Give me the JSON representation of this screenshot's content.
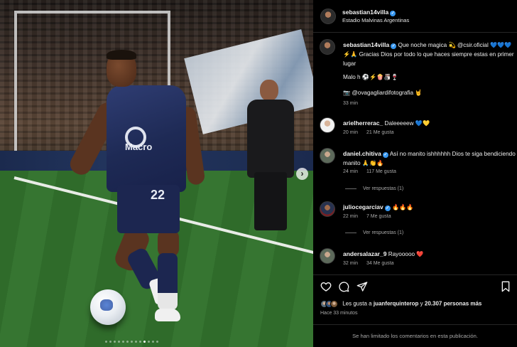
{
  "photo": {
    "sponsor": "Macro",
    "number": "22",
    "nav_arrow": "›",
    "carousel_dots": 13,
    "carousel_active": 9
  },
  "header": {
    "username": "sebastian14villa",
    "location": "Estadio Malvinas Argentinas"
  },
  "caption": {
    "username": "sebastian14villa",
    "text": "Que noche magica 💫 @csir.oficial 💙💙💙⚡🙏 Gracias Dios por todo lo que haces siempre estas en primer lugar",
    "line2": "Malo h ⚽⚡🍿🎳🍷",
    "line3": "📷 @ovagagliardifotografia 🤘",
    "time": "33 min"
  },
  "comments": [
    {
      "username": "arielherrerac_",
      "verified": false,
      "text": "Daleeeeew 💙💛",
      "time": "20 min",
      "likes": "21 Me gusta",
      "replies": ""
    },
    {
      "username": "daniel.chitiva",
      "verified": true,
      "text": "Así no manito ishhhhhh Dios te siga bendiciendo manito 🙏👏🔥",
      "time": "24 min",
      "likes": "117 Me gusta",
      "replies": "Ver respuestas (1)"
    },
    {
      "username": "juliocegarciav",
      "verified": true,
      "text": "🔥🔥🔥",
      "time": "22 min",
      "likes": "7 Me gusta",
      "replies": "Ver respuestas (1)"
    },
    {
      "username": "andersalazar_9",
      "verified": false,
      "text": "Rayooooo ❤️",
      "time": "32 min",
      "likes": "34 Me gusta",
      "replies": ""
    }
  ],
  "footer": {
    "likes_prefix": "Les gusta a",
    "likes_user": "juanferquinterop",
    "likes_connector": "y",
    "likes_count": "20.307 personas más",
    "time": "Hace 33 minutos",
    "limited": "Se han limitado los comentarios en esta publicación."
  },
  "colors": {
    "verified": "#3797f0",
    "bg": "#000000",
    "muted": "#a8a8a8"
  },
  "icons": [
    "heart-icon",
    "comment-icon",
    "share-icon",
    "bookmark-icon",
    "verified-icon"
  ]
}
